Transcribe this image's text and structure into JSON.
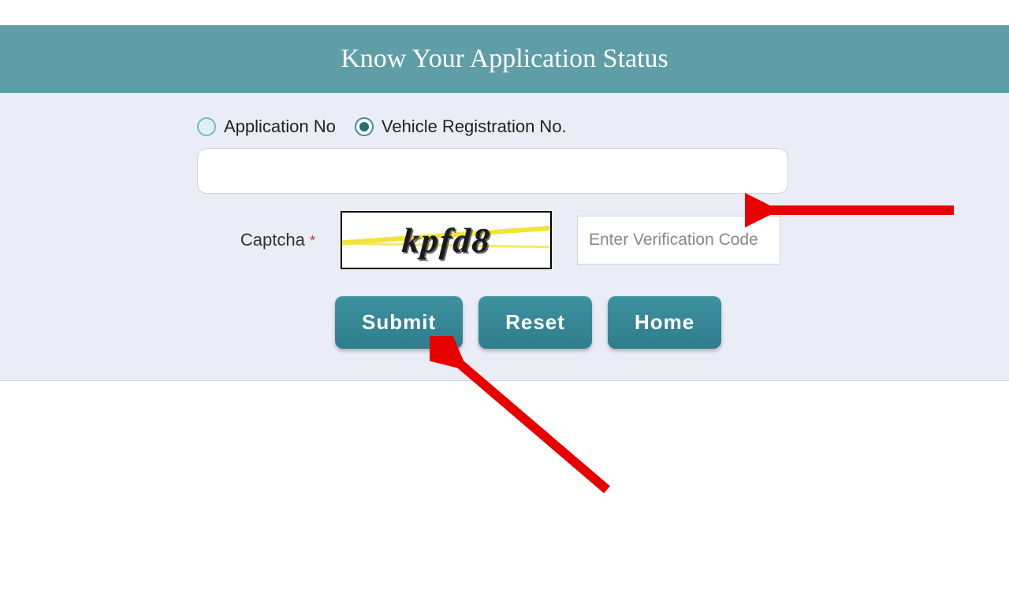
{
  "header": {
    "title": "Know Your Application Status"
  },
  "form": {
    "radios": {
      "option1_label": "Application No",
      "option2_label": "Vehicle Registration No.",
      "selected": "option2"
    },
    "main_input_value": "",
    "captcha": {
      "label": "Captcha",
      "required_marker": "*",
      "image_text": "kpfd8",
      "input_placeholder": "Enter Verification Code",
      "input_value": ""
    },
    "buttons": {
      "submit": "Submit",
      "reset": "Reset",
      "home": "Home"
    }
  },
  "colors": {
    "header_bg": "#5f9ea7",
    "form_bg": "#eaedf5",
    "button_bg": "#34808e",
    "arrow": "#e60000"
  }
}
